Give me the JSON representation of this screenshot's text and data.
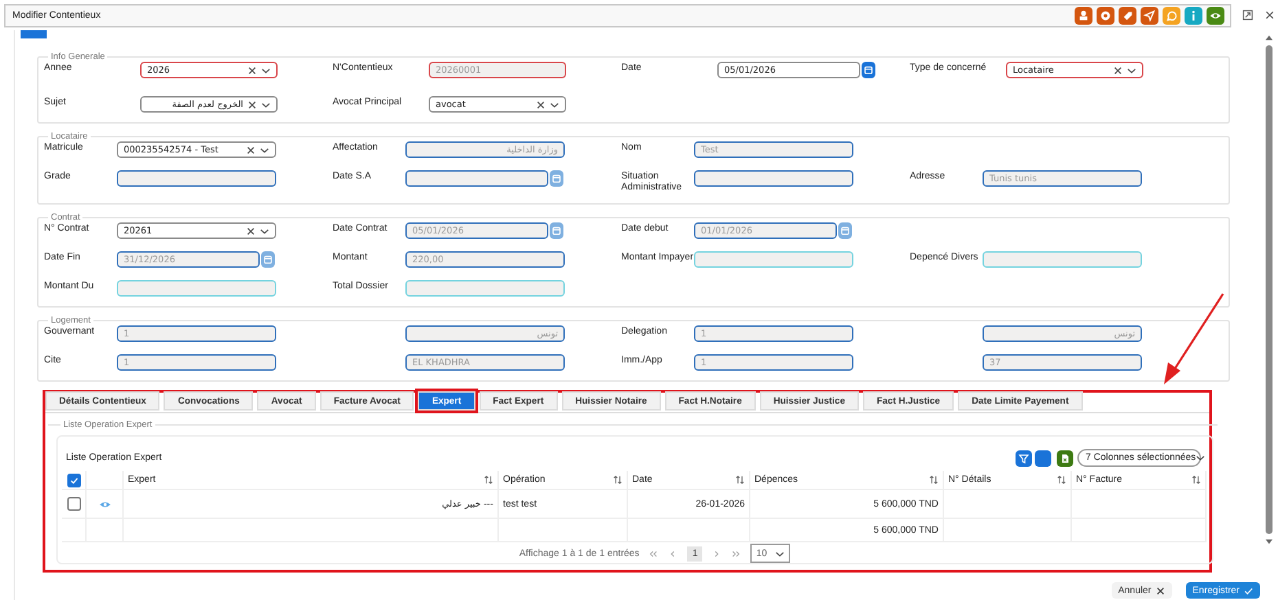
{
  "window": {
    "title": "Modifier Contentieux"
  },
  "toolbar": [
    {
      "kind": "stamp",
      "color": "#d4560f"
    },
    {
      "kind": "gear",
      "color": "#d4560f"
    },
    {
      "kind": "tag",
      "color": "#d4560f"
    },
    {
      "kind": "send",
      "color": "#d4560f"
    },
    {
      "kind": "chat",
      "color": "#f4a322"
    },
    {
      "kind": "info",
      "color": "#17a9c2"
    },
    {
      "kind": "eye",
      "color": "#4a8a14"
    }
  ],
  "sections": [
    {
      "title": "Info Generale",
      "fields": [
        {
          "label": "Annee",
          "kind": "select",
          "invalid": true,
          "readonly": false,
          "value": "2026"
        },
        {
          "label": "N'Contentieux",
          "kind": "text",
          "invalid": true,
          "readonly": true,
          "value": "20260001"
        },
        {
          "label": "Date",
          "kind": "date",
          "invalid": false,
          "readonly": false,
          "value": "05/01/2026"
        },
        {
          "label": "Type de concerné",
          "kind": "select",
          "invalid": true,
          "readonly": false,
          "value": "Locataire"
        },
        {
          "label": "Sujet",
          "kind": "select",
          "invalid": false,
          "readonly": false,
          "value": "الخروج لعدم الصفة"
        },
        {
          "label": "Avocat Principal",
          "kind": "select",
          "invalid": false,
          "readonly": false,
          "value": "avocat"
        }
      ]
    },
    {
      "title": "Locataire",
      "fields": [
        {
          "label": "Matricule",
          "kind": "select",
          "invalid": false,
          "readonly": false,
          "value": "000235542574 - Test"
        },
        {
          "label": "Affectation",
          "kind": "text",
          "invalid": false,
          "readonly": true,
          "value": "وزارة الداخلية"
        },
        {
          "label": "Nom",
          "kind": "text",
          "invalid": false,
          "readonly": true,
          "value": "Test"
        },
        {
          "kind": "none"
        },
        {
          "label": "Grade",
          "kind": "text",
          "invalid": false,
          "readonly": true
        },
        {
          "label": "Date S.A",
          "kind": "date",
          "invalid": false,
          "readonly": true
        },
        {
          "label": "Situation Administrative",
          "kind": "text",
          "invalid": false,
          "readonly": true
        },
        {
          "label": "Adresse",
          "kind": "text",
          "invalid": false,
          "readonly": true,
          "value": "Tunis tunis"
        }
      ]
    },
    {
      "title": "Contrat",
      "fields": [
        {
          "label": "N° Contrat",
          "kind": "select",
          "invalid": false,
          "readonly": false,
          "value": "20261"
        },
        {
          "label": "Date Contrat",
          "kind": "date",
          "invalid": false,
          "readonly": true,
          "value": "05/01/2026"
        },
        {
          "label": "Date debut",
          "kind": "date",
          "invalid": false,
          "readonly": true,
          "value": "01/01/2026"
        },
        {
          "kind": "none"
        },
        {
          "label": "Date Fin",
          "kind": "date",
          "invalid": false,
          "readonly": true,
          "value": "31/12/2026"
        },
        {
          "label": "Montant",
          "kind": "text",
          "invalid": false,
          "readonly": true,
          "value": "220,00"
        },
        {
          "label": "Montant Impayer",
          "kind": "calc",
          "invalid": false,
          "readonly": true
        },
        {
          "label": "Depencé Divers",
          "kind": "calc",
          "invalid": false,
          "readonly": true
        },
        {
          "label": "Montant Du",
          "kind": "calc",
          "invalid": false,
          "readonly": true
        },
        {
          "label": "Total Dossier",
          "kind": "calc",
          "invalid": false,
          "readonly": true
        }
      ]
    },
    {
      "title": "Logement",
      "fields": [
        {
          "label": "Gouvernant",
          "kind": "text",
          "invalid": false,
          "readonly": true,
          "value": "1"
        },
        {
          "kind": "text",
          "invalid": false,
          "readonly": true,
          "value": "تونس"
        },
        {
          "label": "Delegation",
          "kind": "text",
          "invalid": false,
          "readonly": true,
          "value": "1"
        },
        {
          "kind": "text",
          "invalid": false,
          "readonly": true,
          "value": "تونس"
        },
        {
          "label": "Cite",
          "kind": "text",
          "invalid": false,
          "readonly": true,
          "value": "1"
        },
        {
          "kind": "text",
          "invalid": false,
          "readonly": true,
          "value": "EL KHADHRA"
        },
        {
          "label": "Imm./App",
          "kind": "text",
          "invalid": false,
          "readonly": true,
          "value": "1"
        },
        {
          "kind": "text",
          "invalid": false,
          "readonly": true,
          "value": "37"
        }
      ]
    }
  ],
  "tabs": [
    {
      "label": "Détails Contentieux",
      "selected": false
    },
    {
      "label": "Convocations",
      "selected": false
    },
    {
      "label": "Avocat",
      "selected": false
    },
    {
      "label": "Facture Avocat",
      "selected": false
    },
    {
      "label": "Expert",
      "selected": true
    },
    {
      "label": "Fact Expert",
      "selected": false
    },
    {
      "label": "Huissier Notaire",
      "selected": false
    },
    {
      "label": "Fact H.Notaire",
      "selected": false
    },
    {
      "label": "Huissier Justice",
      "selected": false
    },
    {
      "label": "Fact H.Justice",
      "selected": false
    },
    {
      "label": "Date Limite Payement",
      "selected": false
    }
  ],
  "panel": {
    "legend": "Liste Operation Expert",
    "table": {
      "title": "Liste Operation Expert",
      "column_picker": "7 Colonnes sélectionnées",
      "header_checked": true,
      "columns": [
        "Expert",
        "Opération",
        "Date",
        "Dépences",
        "N° Détails",
        "N° Facture"
      ],
      "rows": [
        {
          "checked": false,
          "expert": "--- خبير عدلي",
          "operation": "test test",
          "date": "26-01-2026",
          "depences": "5 600,000 TND"
        }
      ],
      "total_depences": "5 600,000 TND",
      "pager": {
        "info": "Affichage 1 à 1 de 1 entrées",
        "pages": [
          {
            "label": "1",
            "selected": true
          }
        ],
        "page_size": "10"
      }
    }
  },
  "buttons": [
    {
      "kind": "cancel",
      "label": "Annuler"
    },
    {
      "kind": "save",
      "label": "Enregistrer"
    }
  ]
}
